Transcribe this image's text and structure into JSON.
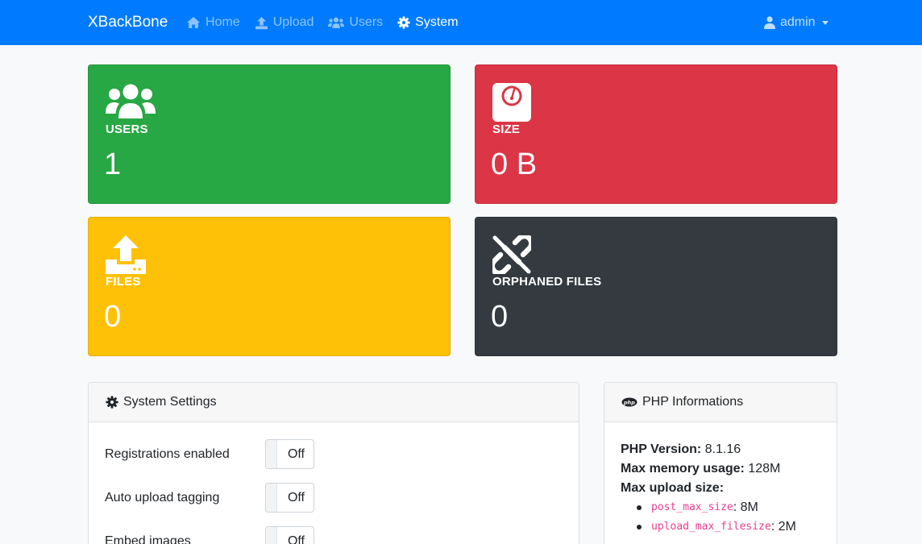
{
  "navbar": {
    "brand": "XBackBone",
    "links": [
      {
        "label": "Home",
        "icon": "home-icon",
        "active": false
      },
      {
        "label": "Upload",
        "icon": "upload-icon",
        "active": false
      },
      {
        "label": "Users",
        "icon": "users-icon",
        "active": false
      },
      {
        "label": "System",
        "icon": "gear-icon",
        "active": true
      }
    ],
    "user": {
      "label": "admin",
      "icon": "user-icon"
    }
  },
  "stats": [
    {
      "label": "USERS",
      "value": "1",
      "icon": "users-icon",
      "color": "#28a745"
    },
    {
      "label": "SIZE",
      "value": "0 B",
      "icon": "weight-scale-icon",
      "color": "#dc3545"
    },
    {
      "label": "FILES",
      "value": "0",
      "icon": "file-upload-icon",
      "color": "#ffc107"
    },
    {
      "label": "ORPHANED FILES",
      "value": "0",
      "icon": "unlink-icon",
      "color": "#343a40"
    }
  ],
  "system_settings": {
    "title": "System Settings",
    "settings": [
      {
        "label": "Registrations enabled",
        "toggle": "Off"
      },
      {
        "label": "Auto upload tagging",
        "toggle": "Off"
      },
      {
        "label": "Embed images",
        "toggle": "Off"
      }
    ]
  },
  "php_info": {
    "title": "PHP Informations",
    "version_label": "PHP Version:",
    "version_value": "8.1.16",
    "memory_label": "Max memory usage:",
    "memory_value": "128M",
    "upload_label": "Max upload size:",
    "limits": [
      {
        "key": "post_max_size",
        "value": "8M"
      },
      {
        "key": "upload_max_filesize",
        "value": "2M"
      }
    ]
  }
}
